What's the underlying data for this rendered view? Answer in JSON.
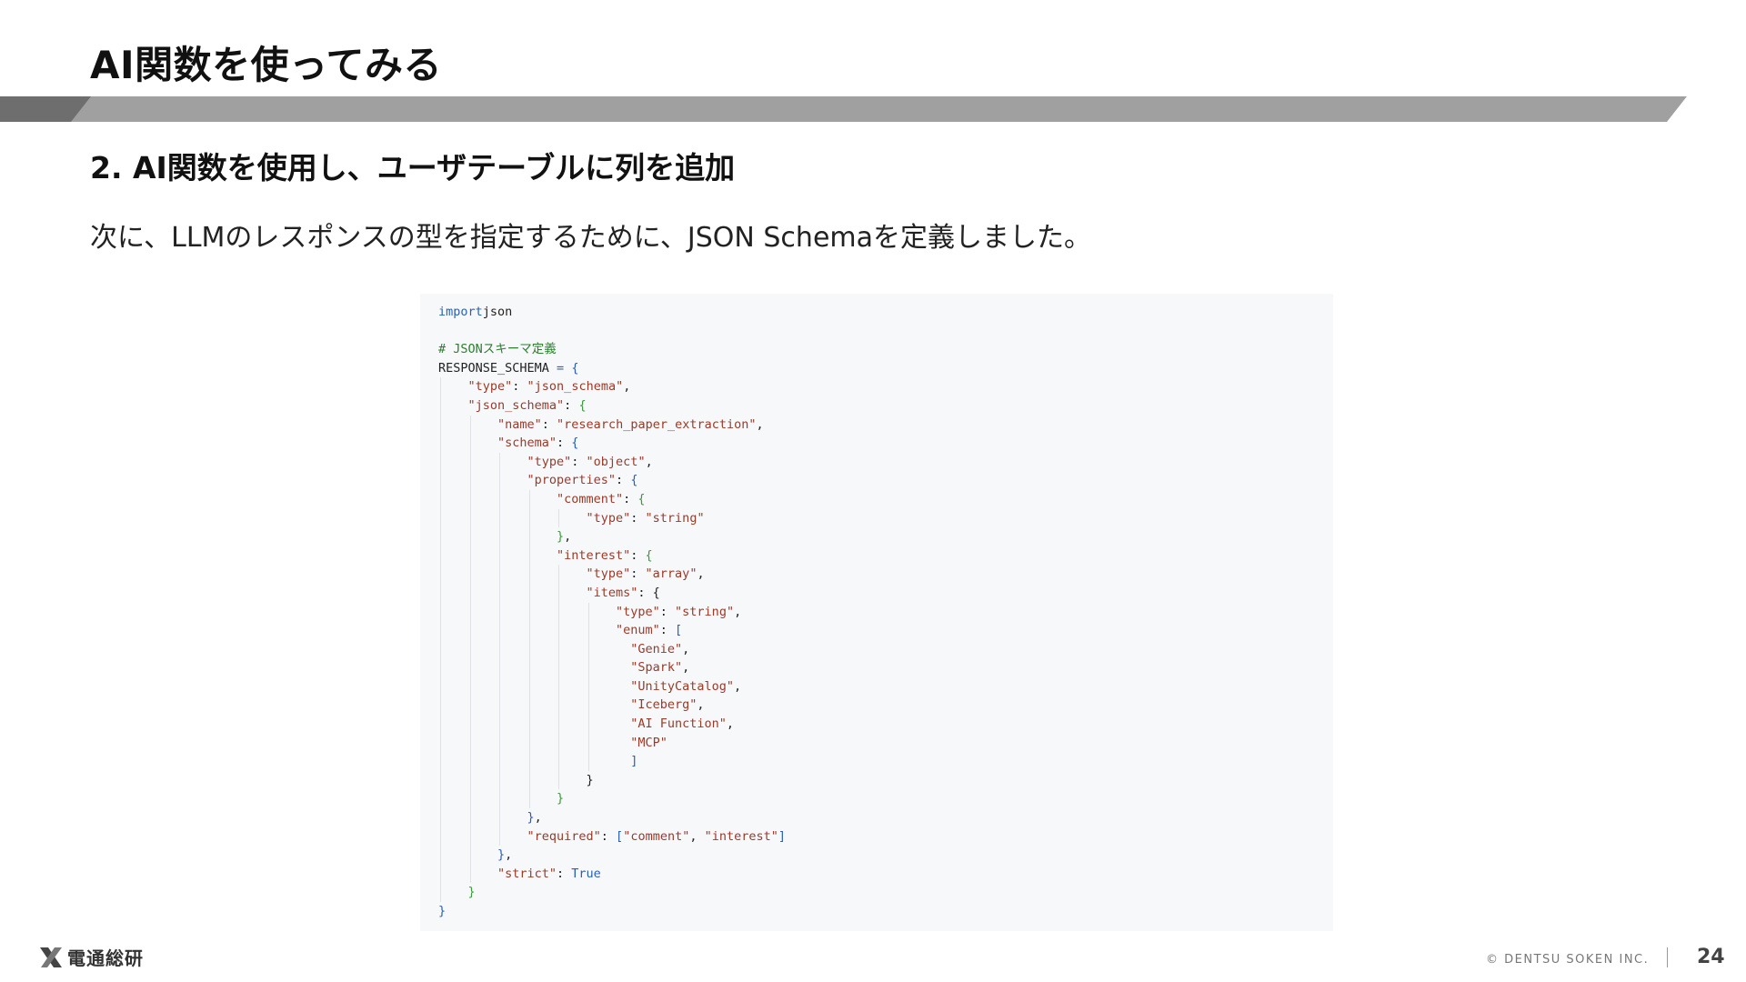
{
  "slide": {
    "title": "AI関数を使ってみる",
    "section_heading": "2. AI関数を使用し、ユーザテーブルに列を追加",
    "description": "次に、LLMのレスポンスの型を指定するために、JSON Schemaを定義しました。"
  },
  "code": {
    "lines": [
      {
        "indent": 0,
        "tokens": [
          [
            "kw",
            "import"
          ],
          [
            "",
            "json"
          ]
        ]
      },
      {
        "indent": 0,
        "tokens": []
      },
      {
        "indent": 0,
        "tokens": [
          [
            "cm",
            "# JSONスキーマ定義"
          ]
        ]
      },
      {
        "indent": 0,
        "tokens": [
          [
            "",
            "RESPONSE_SCHEMA "
          ],
          [
            "kw",
            "="
          ],
          [
            "br1",
            " {"
          ]
        ]
      },
      {
        "indent": 1,
        "tokens": [
          [
            "str",
            "\"type\""
          ],
          [
            "",
            ": "
          ],
          [
            "str",
            "\"json_schema\""
          ],
          [
            "",
            ","
          ]
        ]
      },
      {
        "indent": 1,
        "tokens": [
          [
            "str",
            "\"json_schema\""
          ],
          [
            "",
            ": "
          ],
          [
            "br2",
            "{"
          ]
        ]
      },
      {
        "indent": 2,
        "tokens": [
          [
            "str",
            "\"name\""
          ],
          [
            "",
            ": "
          ],
          [
            "str",
            "\"research_paper_extraction\""
          ],
          [
            "",
            ","
          ]
        ]
      },
      {
        "indent": 2,
        "tokens": [
          [
            "str",
            "\"schema\""
          ],
          [
            "",
            ": "
          ],
          [
            "br1",
            "{"
          ]
        ]
      },
      {
        "indent": 3,
        "tokens": [
          [
            "str",
            "\"type\""
          ],
          [
            "",
            ": "
          ],
          [
            "str",
            "\"object\""
          ],
          [
            "",
            ","
          ]
        ]
      },
      {
        "indent": 3,
        "tokens": [
          [
            "str",
            "\"properties\""
          ],
          [
            "",
            ": "
          ],
          [
            "br1",
            "{"
          ]
        ]
      },
      {
        "indent": 4,
        "tokens": [
          [
            "str",
            "\"comment\""
          ],
          [
            "",
            ": "
          ],
          [
            "br2",
            "{"
          ]
        ]
      },
      {
        "indent": 5,
        "tokens": [
          [
            "str",
            "\"type\""
          ],
          [
            "",
            ": "
          ],
          [
            "str",
            "\"string\""
          ]
        ]
      },
      {
        "indent": 4,
        "tokens": [
          [
            "br2",
            "}"
          ],
          [
            "",
            ","
          ]
        ]
      },
      {
        "indent": 4,
        "tokens": [
          [
            "str",
            "\"interest\""
          ],
          [
            "",
            ": "
          ],
          [
            "br2",
            "{"
          ]
        ]
      },
      {
        "indent": 5,
        "tokens": [
          [
            "str",
            "\"type\""
          ],
          [
            "",
            ": "
          ],
          [
            "str",
            "\"array\""
          ],
          [
            "",
            ","
          ]
        ]
      },
      {
        "indent": 5,
        "tokens": [
          [
            "str",
            "\"items\""
          ],
          [
            "",
            ": "
          ],
          [
            "",
            "{"
          ]
        ]
      },
      {
        "indent": 6,
        "tokens": [
          [
            "str",
            "\"type\""
          ],
          [
            "",
            ": "
          ],
          [
            "str",
            "\"string\""
          ],
          [
            "",
            ","
          ]
        ]
      },
      {
        "indent": 6,
        "tokens": [
          [
            "str",
            "\"enum\""
          ],
          [
            "",
            ": "
          ],
          [
            "br1",
            "["
          ]
        ]
      },
      {
        "indent": 6.5,
        "tokens": [
          [
            "str",
            "\"Genie\""
          ],
          [
            "",
            ","
          ]
        ]
      },
      {
        "indent": 6.5,
        "tokens": [
          [
            "str",
            "\"Spark\""
          ],
          [
            "",
            ","
          ]
        ]
      },
      {
        "indent": 6.5,
        "tokens": [
          [
            "str",
            "\"UnityCatalog\""
          ],
          [
            "",
            ","
          ]
        ]
      },
      {
        "indent": 6.5,
        "tokens": [
          [
            "str",
            "\"Iceberg\""
          ],
          [
            "",
            ","
          ]
        ]
      },
      {
        "indent": 6.5,
        "tokens": [
          [
            "str",
            "\"AI Function\""
          ],
          [
            "",
            ","
          ]
        ]
      },
      {
        "indent": 6.5,
        "tokens": [
          [
            "str",
            "\"MCP\""
          ]
        ]
      },
      {
        "indent": 6.5,
        "tokens": [
          [
            "br1",
            "]"
          ]
        ]
      },
      {
        "indent": 5,
        "tokens": [
          [
            "",
            "}"
          ]
        ]
      },
      {
        "indent": 4,
        "tokens": [
          [
            "br2",
            "}"
          ]
        ]
      },
      {
        "indent": 3,
        "tokens": [
          [
            "br1",
            "}"
          ],
          [
            "",
            ","
          ]
        ]
      },
      {
        "indent": 3,
        "tokens": [
          [
            "str",
            "\"required\""
          ],
          [
            "",
            ": "
          ],
          [
            "br1",
            "["
          ],
          [
            "str",
            "\"comment\""
          ],
          [
            "",
            ", "
          ],
          [
            "str",
            "\"interest\""
          ],
          [
            "br1",
            "]"
          ]
        ]
      },
      {
        "indent": 2,
        "tokens": [
          [
            "br1",
            "}"
          ],
          [
            "",
            ","
          ]
        ]
      },
      {
        "indent": 2,
        "tokens": [
          [
            "str",
            "\"strict\""
          ],
          [
            "",
            ": "
          ],
          [
            "kw",
            "True"
          ]
        ]
      },
      {
        "indent": 1,
        "tokens": [
          [
            "br2",
            "}"
          ]
        ]
      },
      {
        "indent": 0,
        "tokens": [
          [
            "br1",
            "}"
          ]
        ]
      }
    ]
  },
  "footer": {
    "logo_text": "電通総研",
    "copyright": "© DENTSU SOKEN INC.",
    "page_number": "24"
  }
}
